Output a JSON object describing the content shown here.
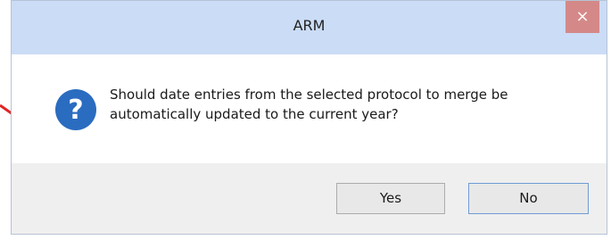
{
  "window": {
    "title": "ARM",
    "close_glyph": "×"
  },
  "message": {
    "text": "Should date entries from the selected protocol to merge be automatically updated to the current year?",
    "icon": "question-icon"
  },
  "buttons": {
    "yes_label": "Yes",
    "no_label": "No"
  },
  "colors": {
    "titlebar": "#cbdcf6",
    "close_button": "#d48988",
    "icon_blue": "#2a6cc0",
    "arrow_red": "#e12525"
  }
}
